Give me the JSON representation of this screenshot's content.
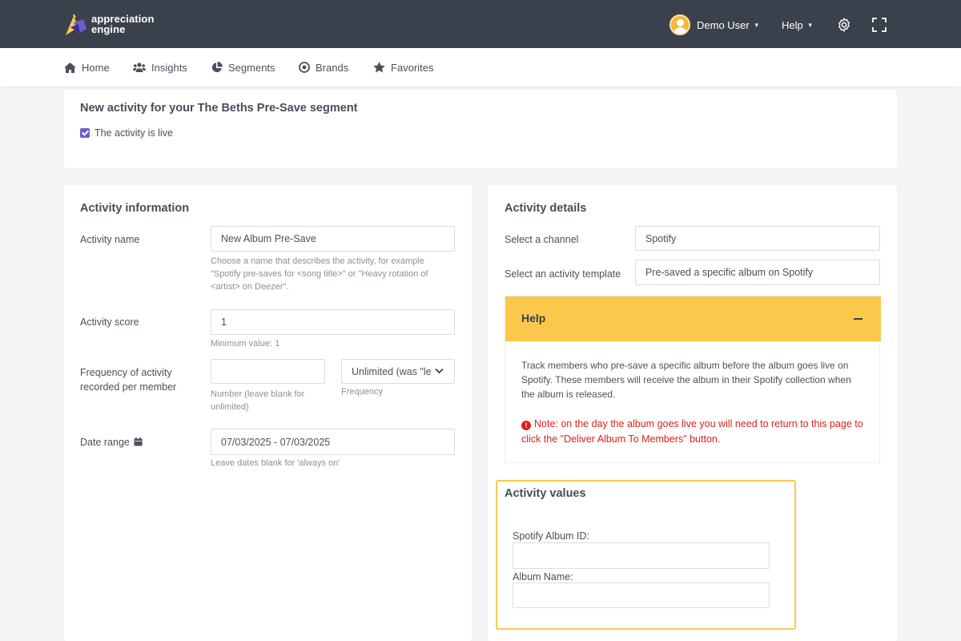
{
  "app": {
    "logo_line1": "appreciation",
    "logo_line2": "engine",
    "accent_color": "#6c5fc7",
    "highlight_color": "#fcc84b",
    "error_color": "#e0201c"
  },
  "header": {
    "user_name": "Demo User",
    "help_label": "Help",
    "icons": [
      "user-avatar",
      "chevron-down-icon",
      "gear-icon",
      "fullscreen-icon"
    ]
  },
  "nav": {
    "items": [
      {
        "label": "Home",
        "icon": "home-icon"
      },
      {
        "label": "Insights",
        "icon": "users-icon"
      },
      {
        "label": "Segments",
        "icon": "pie-chart-icon"
      },
      {
        "label": "Brands",
        "icon": "target-icon"
      },
      {
        "label": "Favorites",
        "icon": "star-icon"
      }
    ]
  },
  "page": {
    "title": "New activity for your The Beths Pre-Save segment",
    "live_checkbox_label": "The activity is live",
    "live_checked": true
  },
  "activity_info": {
    "heading": "Activity information",
    "name_label": "Activity name",
    "name_value": "New Album Pre-Save",
    "name_hint": "Choose a name that describes the activity, for example \"Spotify pre-saves for <song title>\" or \"Heavy rotation of <artist> on Deezer\".",
    "score_label": "Activity score",
    "score_value": "1",
    "score_hint": "Minimum value: 1",
    "frequency_label": "Frequency of activity recorded per member",
    "frequency_number_value": "",
    "frequency_number_hint": "Number (leave blank for unlimited)",
    "frequency_select_value": "Unlimited (was \"le",
    "frequency_select_hint": "Frequency",
    "date_label": "Date range",
    "date_value": "07/03/2025 - 07/03/2025",
    "date_hint": "Leave dates blank for 'always on'"
  },
  "activity_details": {
    "heading": "Activity details",
    "channel_label": "Select a channel",
    "channel_value": "Spotify",
    "template_label": "Select an activity template",
    "template_value": "Pre-saved a specific album on Spotify",
    "help_title": "Help",
    "help_text": "Track members who pre-save a specific album before the album goes live on Spotify. These members will receive the album in their Spotify collection when the album is released.",
    "note_icon": "!",
    "note_text": "Note: on the day the album goes live you will need to return to this page to click the \"Deliver Album To Members\" button."
  },
  "activity_values": {
    "heading": "Activity values",
    "album_id_label": "Spotify Album ID:",
    "album_id_value": "",
    "album_name_label": "Album Name:",
    "album_name_value": ""
  }
}
